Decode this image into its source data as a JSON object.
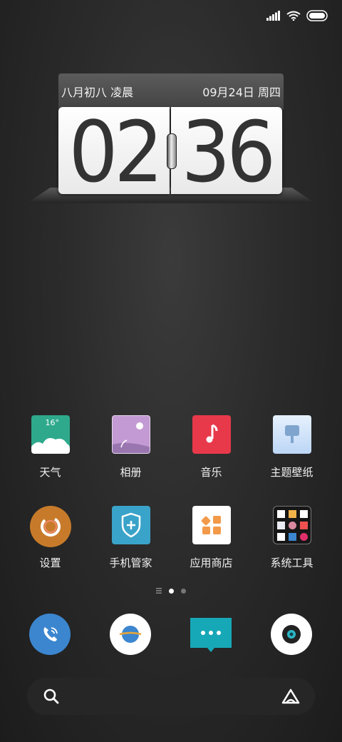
{
  "status": {
    "signal_icon": "signal-icon",
    "wifi_icon": "wifi-icon",
    "battery_icon": "battery-icon"
  },
  "clock": {
    "lunar_date": "八月初八  凌晨",
    "date": "09月24日  周四",
    "hours": "02",
    "minutes": "36"
  },
  "apps": [
    {
      "label": "天气",
      "icon": "weather-icon",
      "temp": "16°",
      "color": "#2ea98c"
    },
    {
      "label": "相册",
      "icon": "gallery-icon",
      "color": "#b392c7"
    },
    {
      "label": "音乐",
      "icon": "music-icon",
      "color": "#e8394a"
    },
    {
      "label": "主题壁纸",
      "icon": "theme-icon",
      "color": "#cfe3fb"
    },
    {
      "label": "设置",
      "icon": "settings-icon",
      "color": "#c77b2a"
    },
    {
      "label": "手机管家",
      "icon": "security-icon",
      "color": "#3aa3c9"
    },
    {
      "label": "应用商店",
      "icon": "app-store-icon",
      "color": "#ffffff"
    },
    {
      "label": "系统工具",
      "icon": "tools-folder-icon",
      "color": "#1a1a1a"
    }
  ],
  "dock": [
    {
      "icon": "phone-icon",
      "color": "#3b86cf"
    },
    {
      "icon": "browser-icon",
      "color": "#ffffff"
    },
    {
      "icon": "messages-icon",
      "color": "#17a8b8"
    },
    {
      "icon": "camera-icon",
      "color": "#ffffff"
    }
  ],
  "search": {
    "search_icon": "search-icon",
    "assistant_icon": "assistant-icon"
  }
}
